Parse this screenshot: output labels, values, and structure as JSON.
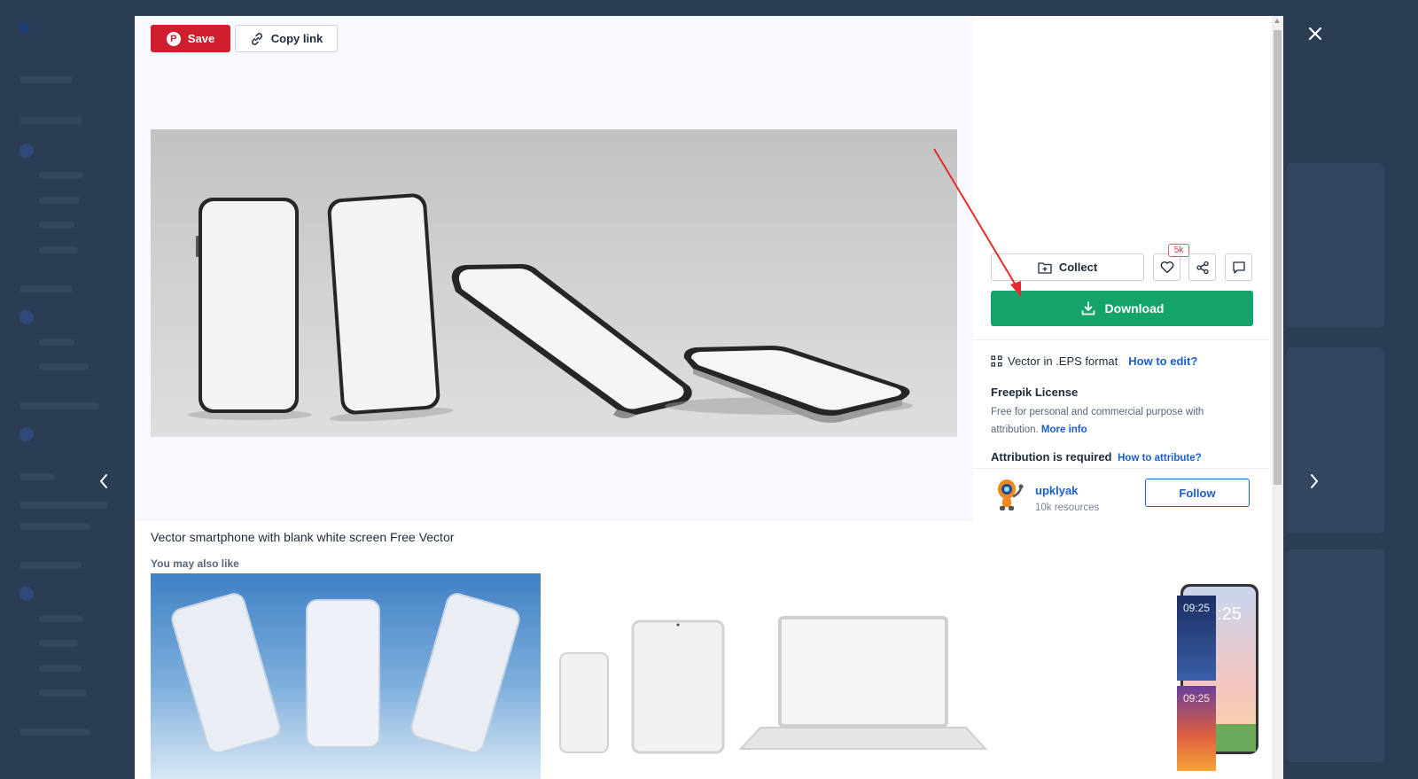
{
  "modal": {
    "save_label": "Save",
    "copy_link_label": "Copy link"
  },
  "sidebar": {
    "collect_label": "Collect",
    "likes_count": "5k",
    "download_label": "Download",
    "format_text": "Vector in .EPS format",
    "how_to_edit": "How to edit?",
    "license_title": "Freepik License",
    "license_desc": "Free for personal and commercial purpose with attribution.",
    "more_info": "More info",
    "attribution_text": "Attribution is required",
    "how_to_attribute": "How to attribute?"
  },
  "author": {
    "name": "upklyak",
    "resources": "10k resources",
    "follow_label": "Follow"
  },
  "item": {
    "title": "Vector smartphone with blank white screen Free Vector",
    "related_heading": "You may also like"
  },
  "related": {
    "clock_1": "09:25",
    "clock_2": "09:25",
    "clock_3": "09:25"
  },
  "colors": {
    "save_red": "#cf1f2e",
    "download_green": "#14a36a",
    "link_blue": "#1a5fd1",
    "annotation_arrow": "#e52b2b"
  }
}
